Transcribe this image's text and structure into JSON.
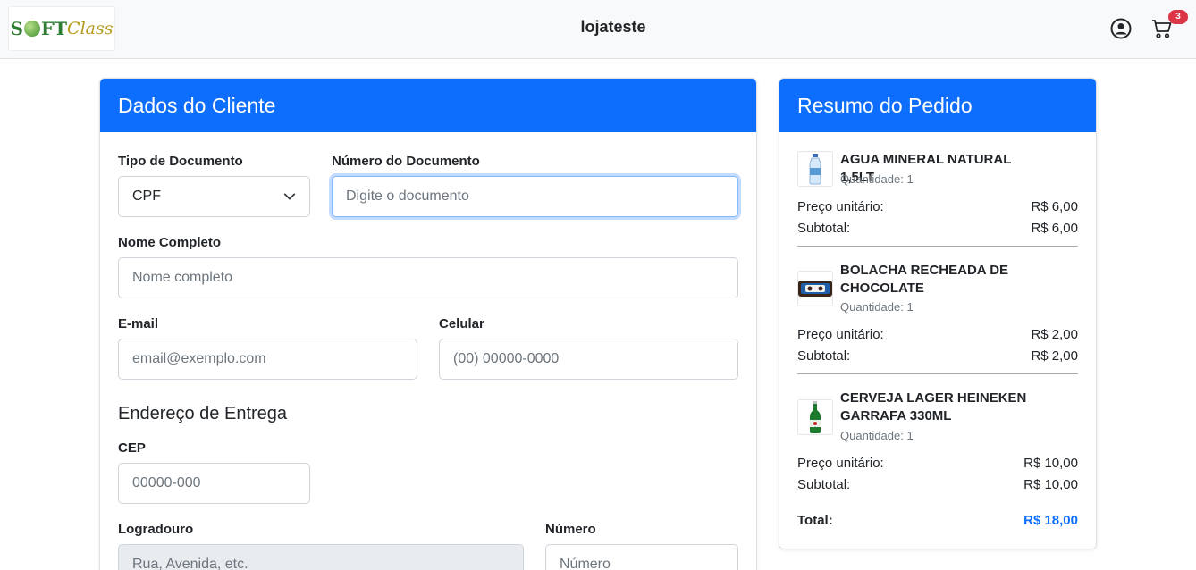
{
  "header": {
    "logo_text_bold_1": "S",
    "logo_text_bold_2": "FT",
    "logo_text_script": "Class",
    "store_name": "lojateste",
    "user_icon": "user-circle-icon",
    "cart_icon": "cart-icon",
    "cart_count": "3",
    "colors": {
      "badge": "#dc3545",
      "primary": "#0d6efd"
    }
  },
  "client": {
    "title": "Dados do Cliente",
    "doc_type_label": "Tipo de Documento",
    "doc_type_value": "CPF",
    "doc_number_label": "Número do Documento",
    "doc_number_placeholder": "Digite o documento",
    "name_label": "Nome Completo",
    "name_placeholder": "Nome completo",
    "email_label": "E-mail",
    "email_placeholder": "email@exemplo.com",
    "phone_label": "Celular",
    "phone_placeholder": "(00) 00000-0000",
    "address_title": "Endereço de Entrega",
    "cep_label": "CEP",
    "cep_placeholder": "00000-000",
    "street_label": "Logradouro",
    "street_placeholder": "Rua, Avenida, etc.",
    "number_label": "Número",
    "number_placeholder": "Número"
  },
  "summary": {
    "title": "Resumo do Pedido",
    "unit_price_label": "Preço unitário:",
    "subtotal_label": "Subtotal:",
    "items": [
      {
        "name": "AGUA MINERAL NATURAL 1,5LT",
        "qty": "Quantidade: 1",
        "unit_price": "R$ 6,00",
        "subtotal": "R$ 6,00"
      },
      {
        "name": "BOLACHA RECHEADA DE CHOCOLATE",
        "qty": "Quantidade: 1",
        "unit_price": "R$ 2,00",
        "subtotal": "R$ 2,00"
      },
      {
        "name": "CERVEJA LAGER HEINEKEN GARRAFA 330ML",
        "qty": "Quantidade: 1",
        "unit_price": "R$ 10,00",
        "subtotal": "R$ 10,00"
      }
    ],
    "total_label": "Total:",
    "total_value": "R$ 18,00"
  }
}
